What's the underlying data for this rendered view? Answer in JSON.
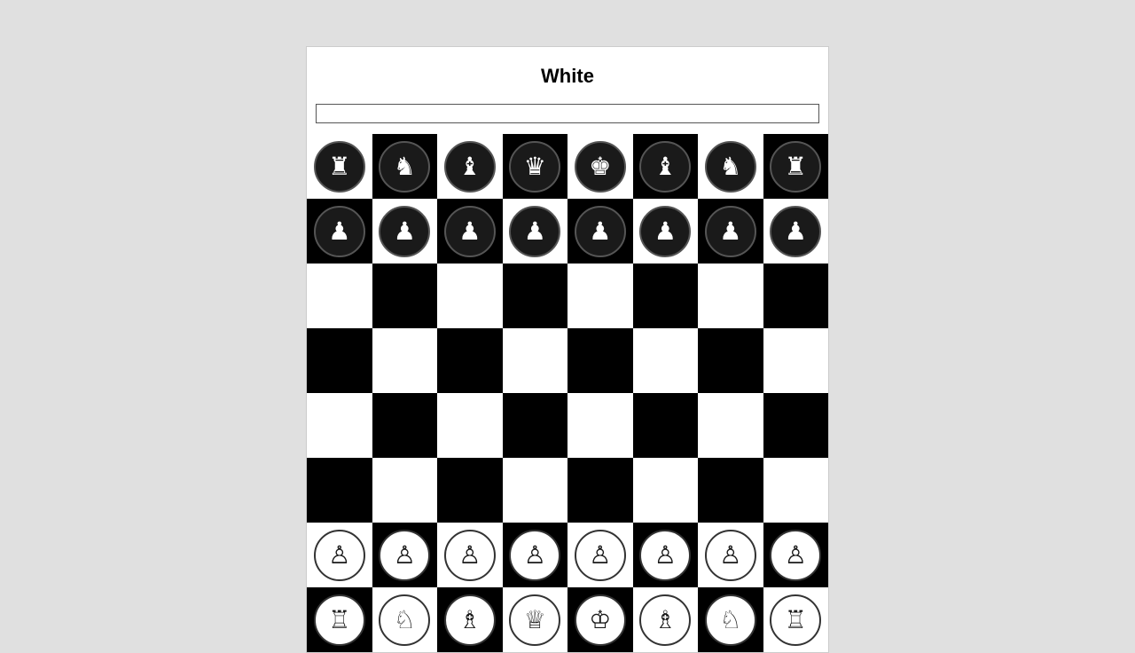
{
  "header": {
    "title": "White"
  },
  "board": {
    "rows": [
      [
        {
          "piece": "♜",
          "type": "dark",
          "name": "black-rook"
        },
        {
          "piece": "♞",
          "type": "dark",
          "name": "black-knight"
        },
        {
          "piece": "♝",
          "type": "dark",
          "name": "black-bishop"
        },
        {
          "piece": "♛",
          "type": "dark",
          "name": "black-queen"
        },
        {
          "piece": "♚",
          "type": "dark",
          "name": "black-king"
        },
        {
          "piece": "♝",
          "type": "dark",
          "name": "black-bishop"
        },
        {
          "piece": "♞",
          "type": "dark",
          "name": "black-knight"
        },
        {
          "piece": "♜",
          "type": "dark",
          "name": "black-rook"
        }
      ],
      [
        {
          "piece": "♟",
          "type": "dark",
          "name": "black-pawn"
        },
        {
          "piece": "♟",
          "type": "dark",
          "name": "black-pawn"
        },
        {
          "piece": "♟",
          "type": "dark",
          "name": "black-pawn"
        },
        {
          "piece": "♟",
          "type": "dark",
          "name": "black-pawn"
        },
        {
          "piece": "♟",
          "type": "dark",
          "name": "black-pawn"
        },
        {
          "piece": "♟",
          "type": "dark",
          "name": "black-pawn"
        },
        {
          "piece": "♟",
          "type": "dark",
          "name": "black-pawn"
        },
        {
          "piece": "♟",
          "type": "dark",
          "name": "black-pawn"
        }
      ],
      [
        null,
        null,
        null,
        null,
        null,
        null,
        null,
        null
      ],
      [
        null,
        null,
        null,
        null,
        null,
        null,
        null,
        null
      ],
      [
        null,
        null,
        null,
        null,
        null,
        null,
        null,
        null
      ],
      [
        null,
        null,
        null,
        null,
        null,
        null,
        null,
        null
      ],
      [
        {
          "piece": "♙",
          "type": "light",
          "name": "white-pawn"
        },
        {
          "piece": "♙",
          "type": "light",
          "name": "white-pawn"
        },
        {
          "piece": "♙",
          "type": "light",
          "name": "white-pawn"
        },
        {
          "piece": "♙",
          "type": "light",
          "name": "white-pawn"
        },
        {
          "piece": "♙",
          "type": "light",
          "name": "white-pawn"
        },
        {
          "piece": "♙",
          "type": "light",
          "name": "white-pawn"
        },
        {
          "piece": "♙",
          "type": "light",
          "name": "white-pawn"
        },
        {
          "piece": "♙",
          "type": "light",
          "name": "white-pawn"
        }
      ],
      [
        {
          "piece": "♖",
          "type": "light",
          "name": "white-rook"
        },
        {
          "piece": "♘",
          "type": "light",
          "name": "white-knight"
        },
        {
          "piece": "♗",
          "type": "light",
          "name": "white-bishop"
        },
        {
          "piece": "♕",
          "type": "light",
          "name": "white-queen"
        },
        {
          "piece": "♔",
          "type": "light",
          "name": "white-king"
        },
        {
          "piece": "♗",
          "type": "light",
          "name": "white-bishop"
        },
        {
          "piece": "♘",
          "type": "light",
          "name": "white-knight"
        },
        {
          "piece": "♖",
          "type": "light",
          "name": "white-rook"
        }
      ]
    ]
  }
}
